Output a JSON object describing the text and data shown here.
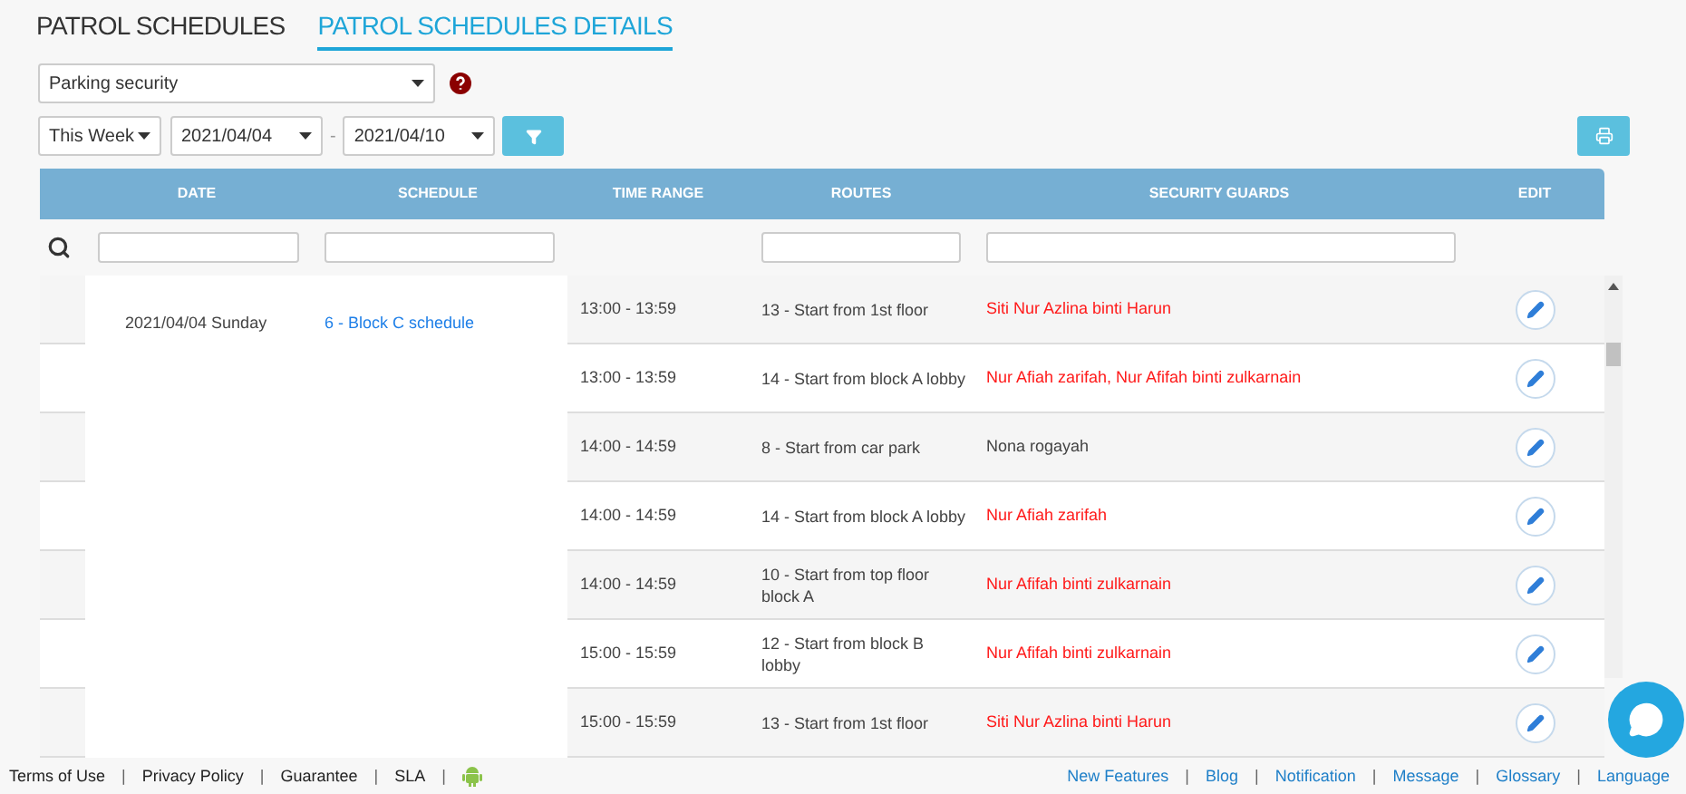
{
  "tabs": [
    {
      "label": "PATROL SCHEDULES",
      "selected": false
    },
    {
      "label": "PATROL SCHEDULES DETAILS",
      "selected": true
    }
  ],
  "site_select": {
    "value": "Parking security"
  },
  "period_select": {
    "value": "This Week"
  },
  "date_from": {
    "value": "2021/04/04"
  },
  "date_separator": "-",
  "date_to": {
    "value": "2021/04/10"
  },
  "table": {
    "columns": [
      "DATE",
      "SCHEDULE",
      "TIME RANGE",
      "ROUTES",
      "SECURITY GUARDS",
      "EDIT"
    ],
    "group": {
      "date": "2021/04/04 Sunday",
      "schedule": "6 - Block C schedule"
    },
    "rows": [
      {
        "time_range": "13:00 - 13:59",
        "route": "13 - Start from 1st floor",
        "guards": "Siti Nur Azlina binti Harun",
        "highlighted": true
      },
      {
        "time_range": "13:00 - 13:59",
        "route": "14 - Start from block A lobby",
        "guards": "Nur Afiah zarifah, Nur Afifah binti zulkarnain",
        "highlighted": true
      },
      {
        "time_range": "14:00 - 14:59",
        "route": "8 - Start from car park",
        "guards": "Nona rogayah",
        "highlighted": false
      },
      {
        "time_range": "14:00 - 14:59",
        "route": "14 - Start from block A lobby",
        "guards": "Nur Afiah zarifah",
        "highlighted": true
      },
      {
        "time_range": "14:00 - 14:59",
        "route": "10 - Start from top floor block A",
        "guards": "Nur Afifah binti zulkarnain",
        "highlighted": true
      },
      {
        "time_range": "15:00 - 15:59",
        "route": "12 - Start from block B lobby",
        "guards": "Nur Afifah binti zulkarnain",
        "highlighted": true
      },
      {
        "time_range": "15:00 - 15:59",
        "route": "13 - Start from 1st floor",
        "guards": "Siti Nur Azlina binti Harun",
        "highlighted": true
      }
    ]
  },
  "footer": {
    "separator": "|",
    "left_links": [
      "Terms of Use",
      "Privacy Policy",
      "Guarantee",
      "SLA"
    ],
    "right_links": [
      "New Features",
      "Blog",
      "Notification",
      "Message",
      "Glossary",
      "Language"
    ]
  }
}
